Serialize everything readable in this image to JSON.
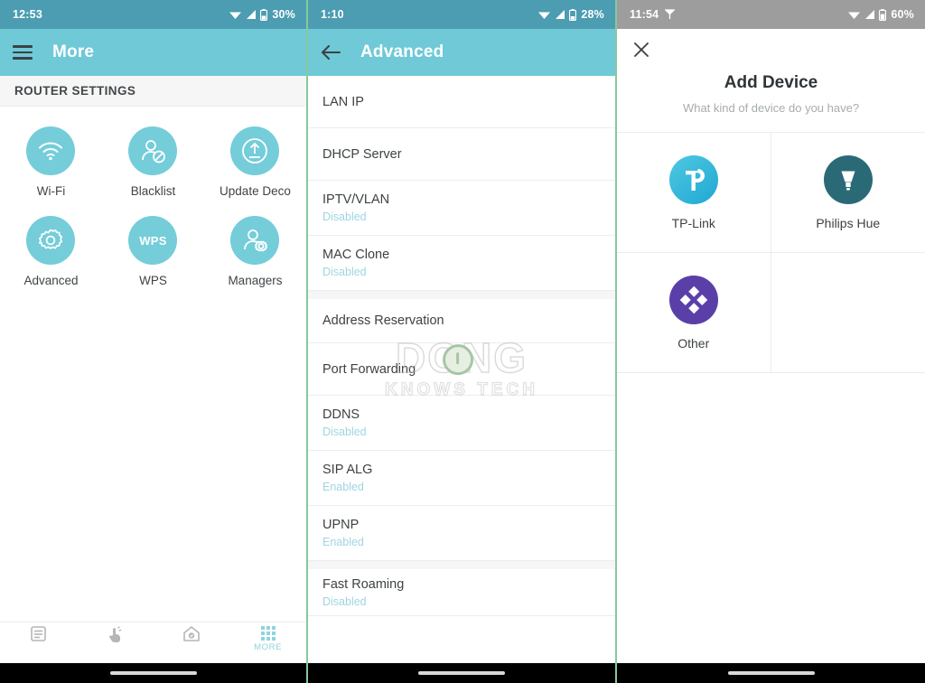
{
  "colors": {
    "status_teal": "#4c9cb2",
    "status_gray": "#9d9d9d",
    "appbar_teal": "#6fc9d7",
    "icon_circle": "#74cdd9",
    "sub_text": "#9ed6e0",
    "tab_active": "#8fd4e0",
    "tplink_blue": "#29b6d8",
    "hue_teal": "#2a6a77",
    "other_purple": "#5b3fa8",
    "panel_divider_green": "#86c99c"
  },
  "panel1": {
    "status": {
      "time": "12:53",
      "battery": "30%",
      "icons": [
        "wifi-icon",
        "signal-icon",
        "battery-icon"
      ]
    },
    "appbar": {
      "menu_icon": "hamburger-icon",
      "title": "More"
    },
    "section_header": "ROUTER SETTINGS",
    "tiles": [
      {
        "label": "Wi-Fi",
        "icon": "wifi-icon"
      },
      {
        "label": "Blacklist",
        "icon": "user-block-icon"
      },
      {
        "label": "Update Deco",
        "icon": "upload-box-icon"
      },
      {
        "label": "Advanced",
        "icon": "gear-icon"
      },
      {
        "label": "WPS",
        "icon": "wps-text-icon",
        "icon_text": "WPS"
      },
      {
        "label": "Managers",
        "icon": "user-gear-icon"
      }
    ],
    "tabbar": [
      {
        "label": "",
        "icon": "overview-icon",
        "active": false
      },
      {
        "label": "",
        "icon": "tap-hand-icon",
        "active": false
      },
      {
        "label": "",
        "icon": "home-shield-icon",
        "active": false
      },
      {
        "label": "MORE",
        "icon": "grid-dots-icon",
        "active": true
      }
    ]
  },
  "panel2": {
    "status": {
      "time": "1:10",
      "battery": "28%",
      "icons": [
        "wifi-icon",
        "signal-icon",
        "battery-icon"
      ]
    },
    "appbar": {
      "back_icon": "back-arrow-icon",
      "title": "Advanced"
    },
    "watermark": {
      "main": "DONG",
      "sub": "KNOWS TECH"
    },
    "rows": [
      {
        "title": "LAN IP",
        "sub": "",
        "gap_before": false
      },
      {
        "title": "DHCP Server",
        "sub": "",
        "gap_before": false
      },
      {
        "title": "IPTV/VLAN",
        "sub": "Disabled",
        "gap_before": false
      },
      {
        "title": "MAC Clone",
        "sub": "Disabled",
        "gap_before": false
      },
      {
        "title": "Address Reservation",
        "sub": "",
        "gap_before": true
      },
      {
        "title": "Port Forwarding",
        "sub": "",
        "gap_before": false
      },
      {
        "title": "DDNS",
        "sub": "Disabled",
        "gap_before": false
      },
      {
        "title": "SIP ALG",
        "sub": "Enabled",
        "gap_before": false
      },
      {
        "title": "UPNP",
        "sub": "Enabled",
        "gap_before": false
      },
      {
        "title": "Fast Roaming",
        "sub": "Disabled",
        "gap_before": true
      }
    ]
  },
  "panel3": {
    "status": {
      "time": "11:54",
      "battery": "60%",
      "icons": [
        "cast-icon",
        "wifi-icon",
        "signal-icon",
        "battery-icon"
      ]
    },
    "close_icon": "close-icon",
    "title": "Add Device",
    "subtitle": "What kind of device do you have?",
    "devices": [
      {
        "label": "TP-Link",
        "icon": "tplink-logo-icon"
      },
      {
        "label": "Philips Hue",
        "icon": "philips-hue-bulb-icon"
      },
      {
        "label": "Other",
        "icon": "other-diamonds-icon"
      }
    ]
  }
}
